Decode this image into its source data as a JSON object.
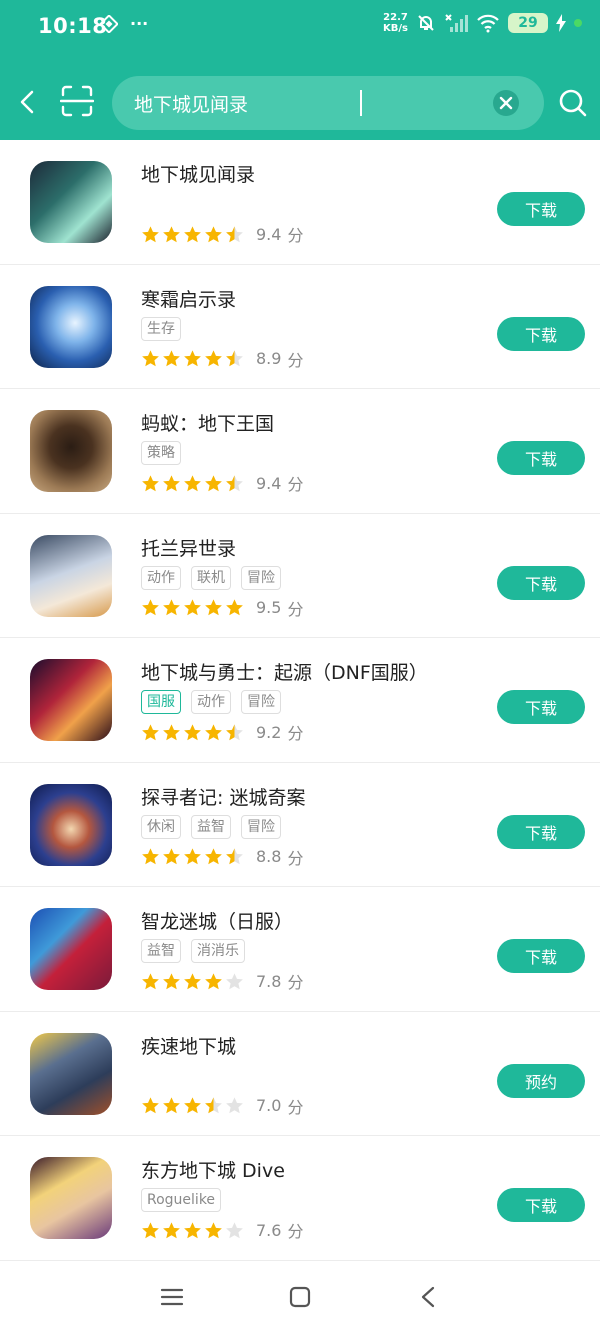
{
  "status_bar": {
    "time": "10:18",
    "extra": "···",
    "net_speed_value": "22.7",
    "net_speed_unit": "KB/s",
    "battery": "29"
  },
  "search": {
    "query": "地下城见闻录"
  },
  "colors": {
    "accent": "#1fb89a",
    "star_filled": "#f7b500",
    "star_empty": "#e3e3e3"
  },
  "apps": [
    {
      "name": "地下城见闻录",
      "tags": [],
      "stars": 4.5,
      "score": "9.4",
      "unit": "分",
      "button": "下载"
    },
    {
      "name": "寒霜启示录",
      "tags": [
        "生存"
      ],
      "stars": 4.5,
      "score": "8.9",
      "unit": "分",
      "button": "下载"
    },
    {
      "name": "蚂蚁：地下王国",
      "tags": [
        "策略"
      ],
      "stars": 4.5,
      "score": "9.4",
      "unit": "分",
      "button": "下载"
    },
    {
      "name": "托兰异世录",
      "tags": [
        "动作",
        "联机",
        "冒险"
      ],
      "stars": 5,
      "score": "9.5",
      "unit": "分",
      "button": "下载"
    },
    {
      "name": "地下城与勇士：起源（DNF国服）",
      "tags": [
        "国服",
        "动作",
        "冒险"
      ],
      "highlight_tag": 0,
      "stars": 4.5,
      "score": "9.2",
      "unit": "分",
      "button": "下载"
    },
    {
      "name": "探寻者记: 迷城奇案",
      "tags": [
        "休闲",
        "益智",
        "冒险"
      ],
      "stars": 4.5,
      "score": "8.8",
      "unit": "分",
      "button": "下载"
    },
    {
      "name": "智龙迷城（日服）",
      "tags": [
        "益智",
        "消消乐"
      ],
      "stars": 4,
      "score": "7.8",
      "unit": "分",
      "button": "下载"
    },
    {
      "name": "疾速地下城",
      "tags": [],
      "stars": 3.5,
      "score": "7.0",
      "unit": "分",
      "button": "预约"
    },
    {
      "name": "东方地下城 Dive",
      "tags": [
        "Roguelike"
      ],
      "stars": 4,
      "score": "7.6",
      "unit": "分",
      "button": "下载"
    }
  ]
}
